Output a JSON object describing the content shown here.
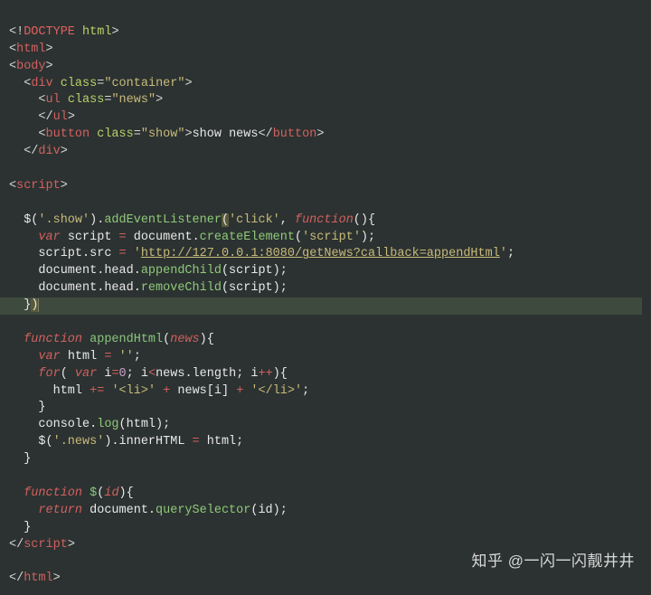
{
  "watermark": "知乎 @一闪一闪靓井井",
  "code": {
    "line1": {
      "bracket1": "<!",
      "doctype": "DOCTYPE",
      "space": " ",
      "attr": "html",
      "bracket2": ">"
    },
    "line2": {
      "b1": "<",
      "tag": "html",
      "b2": ">"
    },
    "line3": {
      "b1": "<",
      "tag": "body",
      "b2": ">"
    },
    "line4": {
      "b1": "<",
      "tag": "div",
      "sp": " ",
      "an": "class",
      "eq": "=",
      "av": "\"container\"",
      "b2": ">"
    },
    "line5": {
      "b1": "<",
      "tag": "ul",
      "sp": " ",
      "an": "class",
      "eq": "=",
      "av": "\"news\"",
      "b2": ">"
    },
    "line6": {
      "b1": "</",
      "tag": "ul",
      "b2": ">"
    },
    "line7": {
      "b1": "<",
      "tag": "button",
      "sp": " ",
      "an": "class",
      "eq": "=",
      "av": "\"show\"",
      "b2": ">",
      "text": "show news",
      "b3": "</",
      "tag2": "button",
      "b4": ">"
    },
    "line8": {
      "b1": "</",
      "tag": "div",
      "b2": ">"
    },
    "line9": "",
    "line10": {
      "b1": "<",
      "tag": "script",
      "b2": ">"
    },
    "line11": "",
    "line12": {
      "t1": "$(",
      "s1": "'.show'",
      "t2": ").",
      "m1": "addEventListener",
      "ph": "(",
      "s2": "'click'",
      "cm": ", ",
      "kw": "function",
      "t3": "(){"
    },
    "line13": {
      "kw": "var",
      "sp": " ",
      "id": "script ",
      "eq": "=",
      "t1": " document.",
      "m1": "createElement",
      "t2": "(",
      "s1": "'script'",
      "t3": ");"
    },
    "line14": {
      "t1": "script.src ",
      "eq": "=",
      "sp": " ",
      "q1": "'",
      "url": "http://127.0.0.1:8080/getNews?callback=appendHtml",
      "q2": "'",
      "sc": ";"
    },
    "line15": {
      "t1": "document.head.",
      "m1": "appendChild",
      "t2": "(script);"
    },
    "line16": {
      "t1": "document.head.",
      "m1": "removeChild",
      "t2": "(script);"
    },
    "line17": {
      "t1": "}",
      "t2": ")"
    },
    "line18": "",
    "line19": {
      "kw": "function",
      "sp": " ",
      "fn": "appendHtml",
      "t1": "(",
      "arg": "news",
      "t2": "){"
    },
    "line20": {
      "kw": "var",
      "sp": " ",
      "id": "html ",
      "eq": "=",
      "sp2": " ",
      "s1": "''",
      "sc": ";"
    },
    "line21": {
      "kw": "for",
      "t1": "( ",
      "kw2": "var",
      "t2": " i",
      "eq": "=",
      "n1": "0",
      "t3": "; i",
      "op": "<",
      "t4": "news.length; i",
      "op2": "++",
      "t5": "){"
    },
    "line22": {
      "t1": "html ",
      "op": "+=",
      "sp": " ",
      "s1": "'<li>'",
      "sp2": " ",
      "op2": "+",
      "sp3": " news[i] ",
      "op3": "+",
      "sp4": " ",
      "s2": "'</li>'",
      "sc": ";"
    },
    "line23": {
      "t1": "}"
    },
    "line24": {
      "t1": "console.",
      "m1": "log",
      "t2": "(html);"
    },
    "line25": {
      "t1": "$(",
      "s1": "'.news'",
      "t2": ").innerHTML ",
      "eq": "=",
      "t3": " html;"
    },
    "line26": {
      "t1": "}"
    },
    "line27": "",
    "line28": {
      "kw": "function",
      "sp": " ",
      "fn": "$",
      "t1": "(",
      "arg": "id",
      "t2": "){"
    },
    "line29": {
      "kw": "return",
      "t1": " document.",
      "m1": "querySelector",
      "t2": "(id);"
    },
    "line30": {
      "t1": "}"
    },
    "line31": {
      "b1": "</",
      "tag": "script",
      "b2": ">"
    },
    "line32": "",
    "line33": {
      "b1": "</",
      "tag": "html",
      "b2": ">"
    }
  }
}
